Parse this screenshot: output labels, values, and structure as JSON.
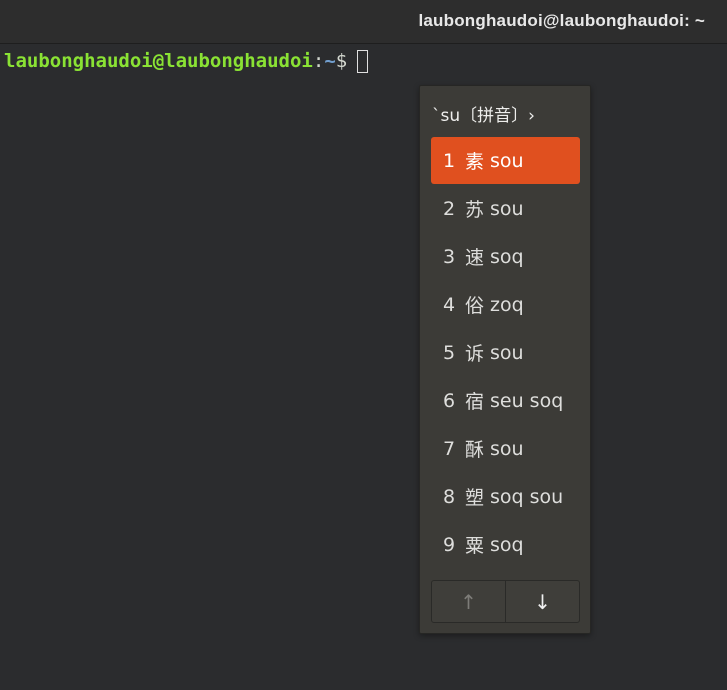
{
  "window": {
    "title": "laubonghaudoi@laubonghaudoi: ~"
  },
  "terminal": {
    "prompt_user": "laubonghaudoi@laubonghaudoi",
    "prompt_sep": ":",
    "prompt_path": "~",
    "prompt_dollar": "$"
  },
  "ime": {
    "preedit": "`su〔拼音〕›",
    "candidates": [
      {
        "index": "1",
        "char": "素",
        "code": "sou",
        "selected": true
      },
      {
        "index": "2",
        "char": "苏",
        "code": "sou",
        "selected": false
      },
      {
        "index": "3",
        "char": "速",
        "code": "soq",
        "selected": false
      },
      {
        "index": "4",
        "char": "俗",
        "code": "zoq",
        "selected": false
      },
      {
        "index": "5",
        "char": "诉",
        "code": "sou",
        "selected": false
      },
      {
        "index": "6",
        "char": "宿",
        "code": "seu soq",
        "selected": false
      },
      {
        "index": "7",
        "char": "酥",
        "code": "sou",
        "selected": false
      },
      {
        "index": "8",
        "char": "塑",
        "code": "soq sou",
        "selected": false
      },
      {
        "index": "9",
        "char": "粟",
        "code": "soq",
        "selected": false
      }
    ],
    "pager": {
      "prev_icon": "arrow-up-icon",
      "next_icon": "arrow-down-icon",
      "prev_glyph": "↑",
      "next_glyph": "↓"
    },
    "colors": {
      "selected_bg": "#e0501f",
      "popup_bg": "#3c3b37"
    }
  }
}
